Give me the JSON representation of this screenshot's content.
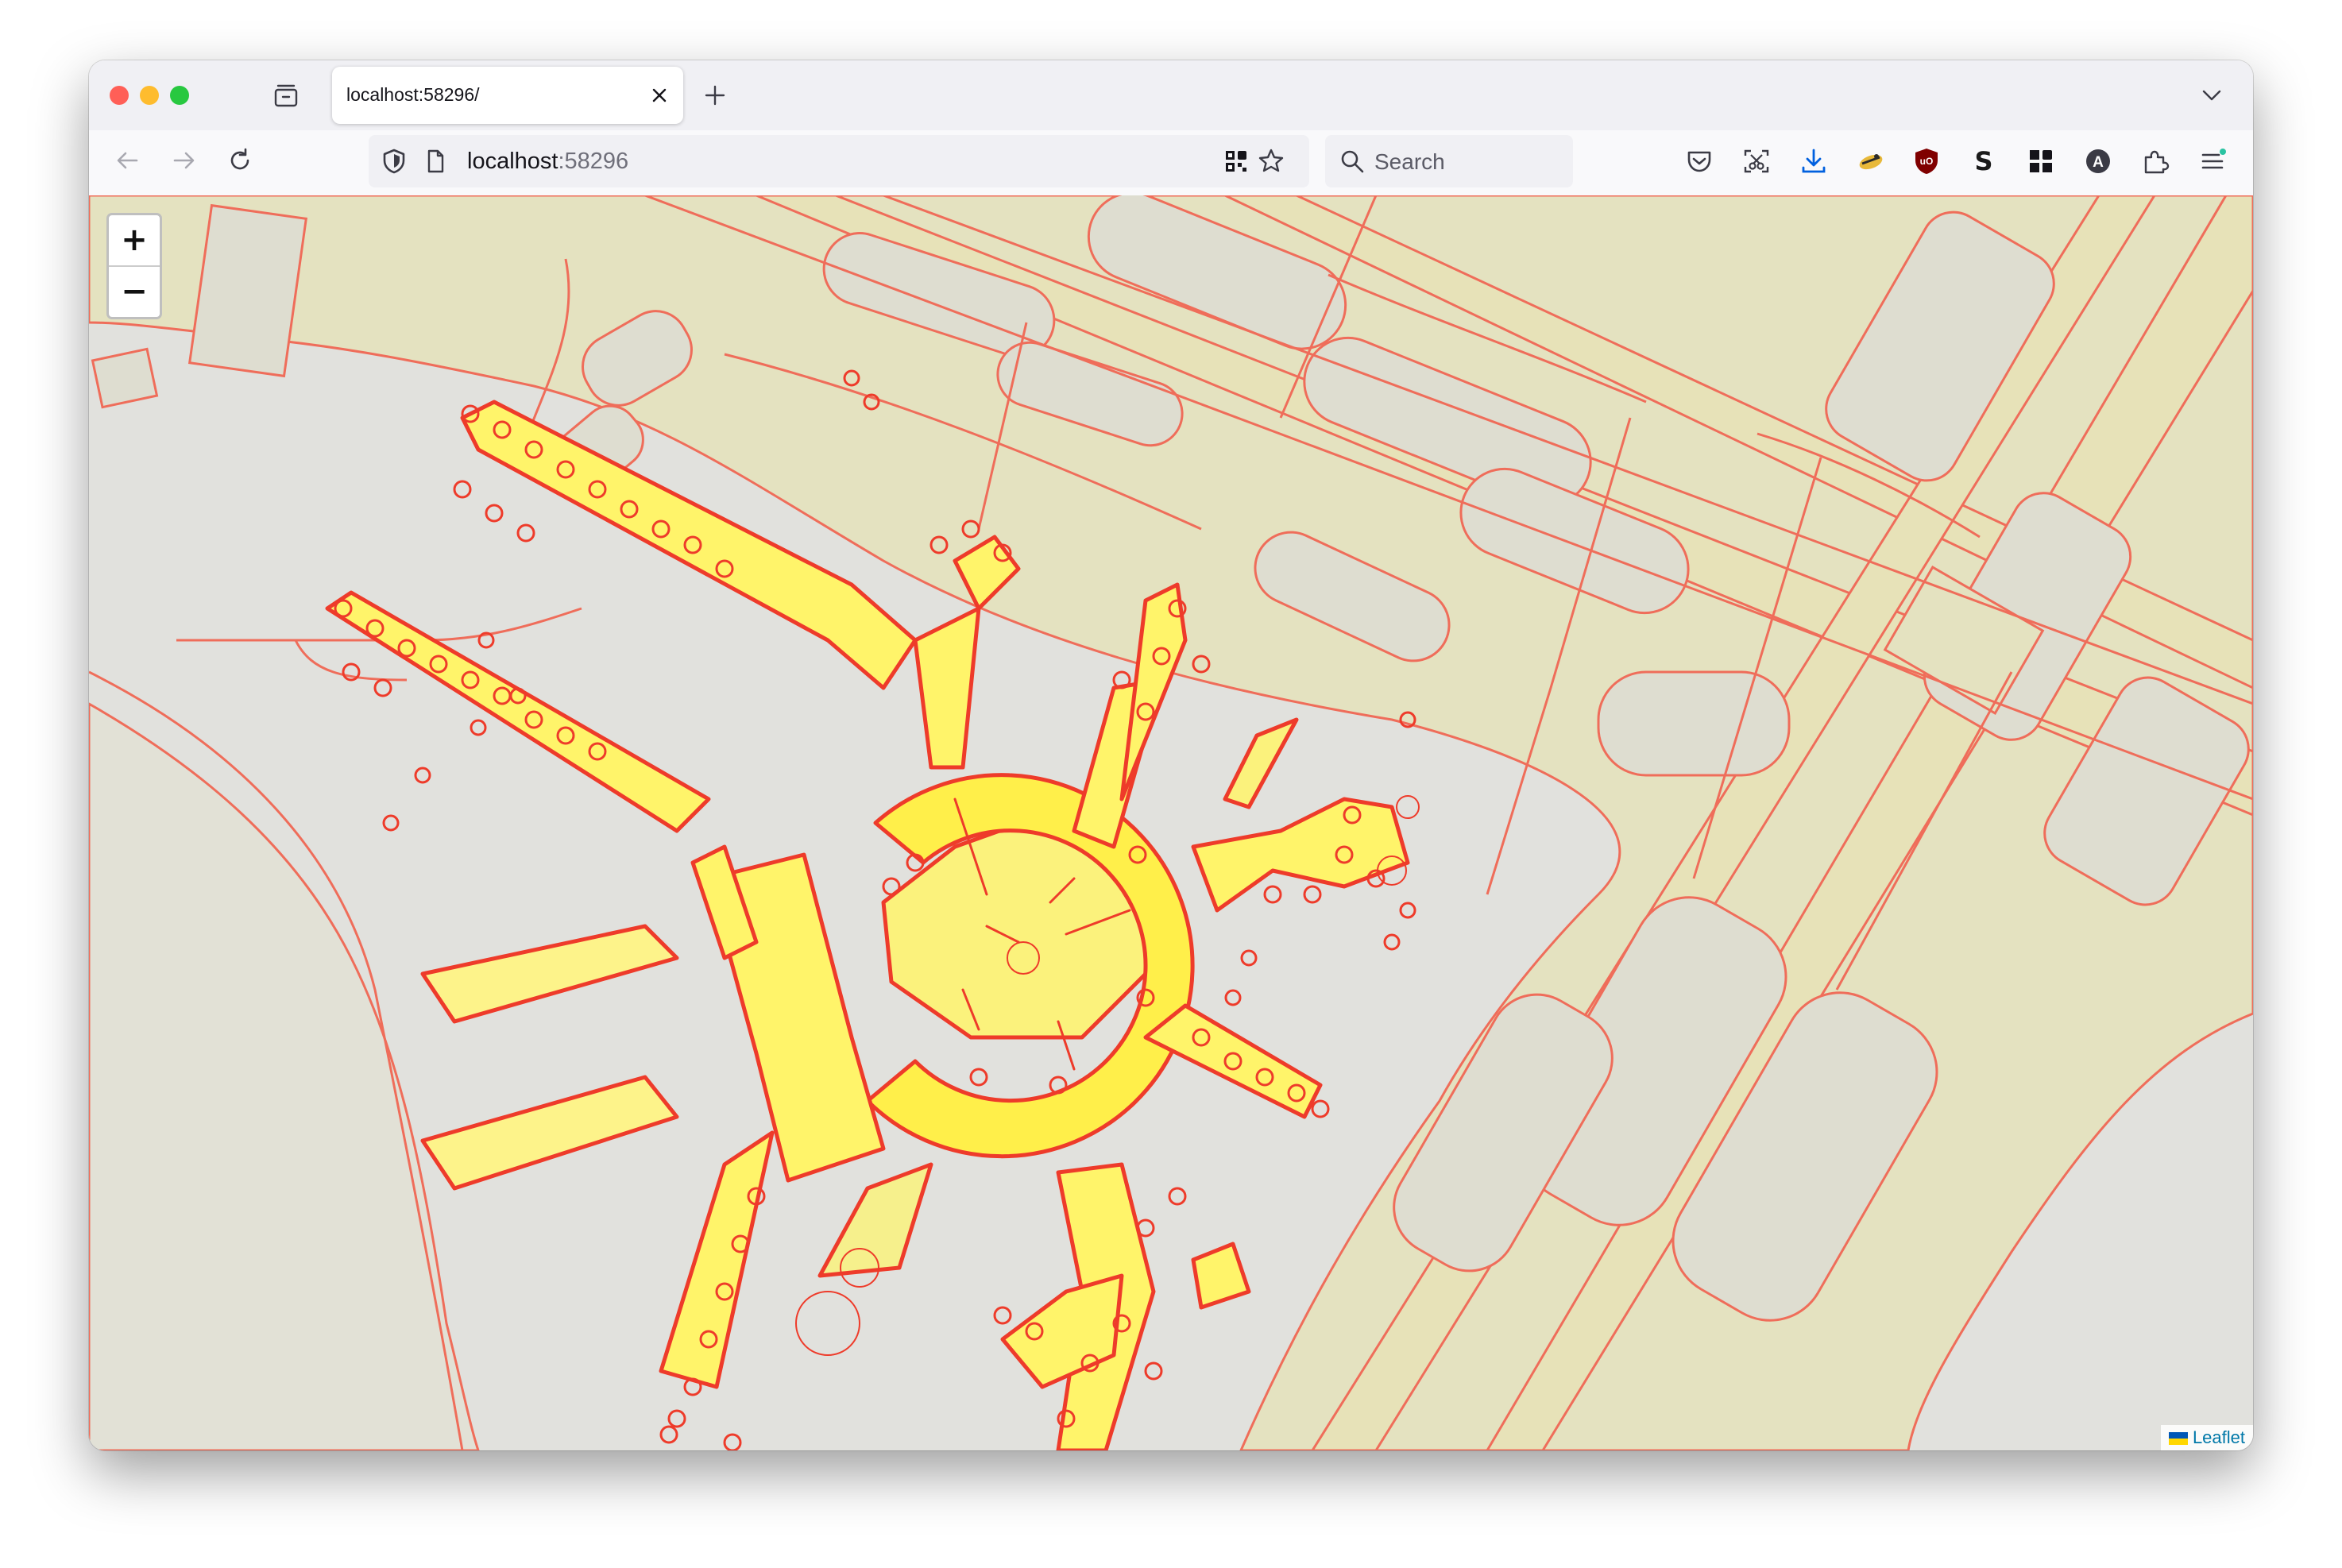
{
  "browser": {
    "tab": {
      "title": "localhost:58296/"
    },
    "url": {
      "host": "localhost",
      "port": ":58296"
    },
    "search": {
      "placeholder": "Search"
    }
  },
  "map": {
    "zoom_in_label": "+",
    "zoom_out_label": "−",
    "attribution": "Leaflet",
    "colors": {
      "land": "#e1e1dd",
      "area_fill": "#e4e2c0",
      "area_stroke": "#ef6d5a",
      "terminal_fill": "#fff46a",
      "terminal_stroke": "#ee3b2a"
    }
  }
}
